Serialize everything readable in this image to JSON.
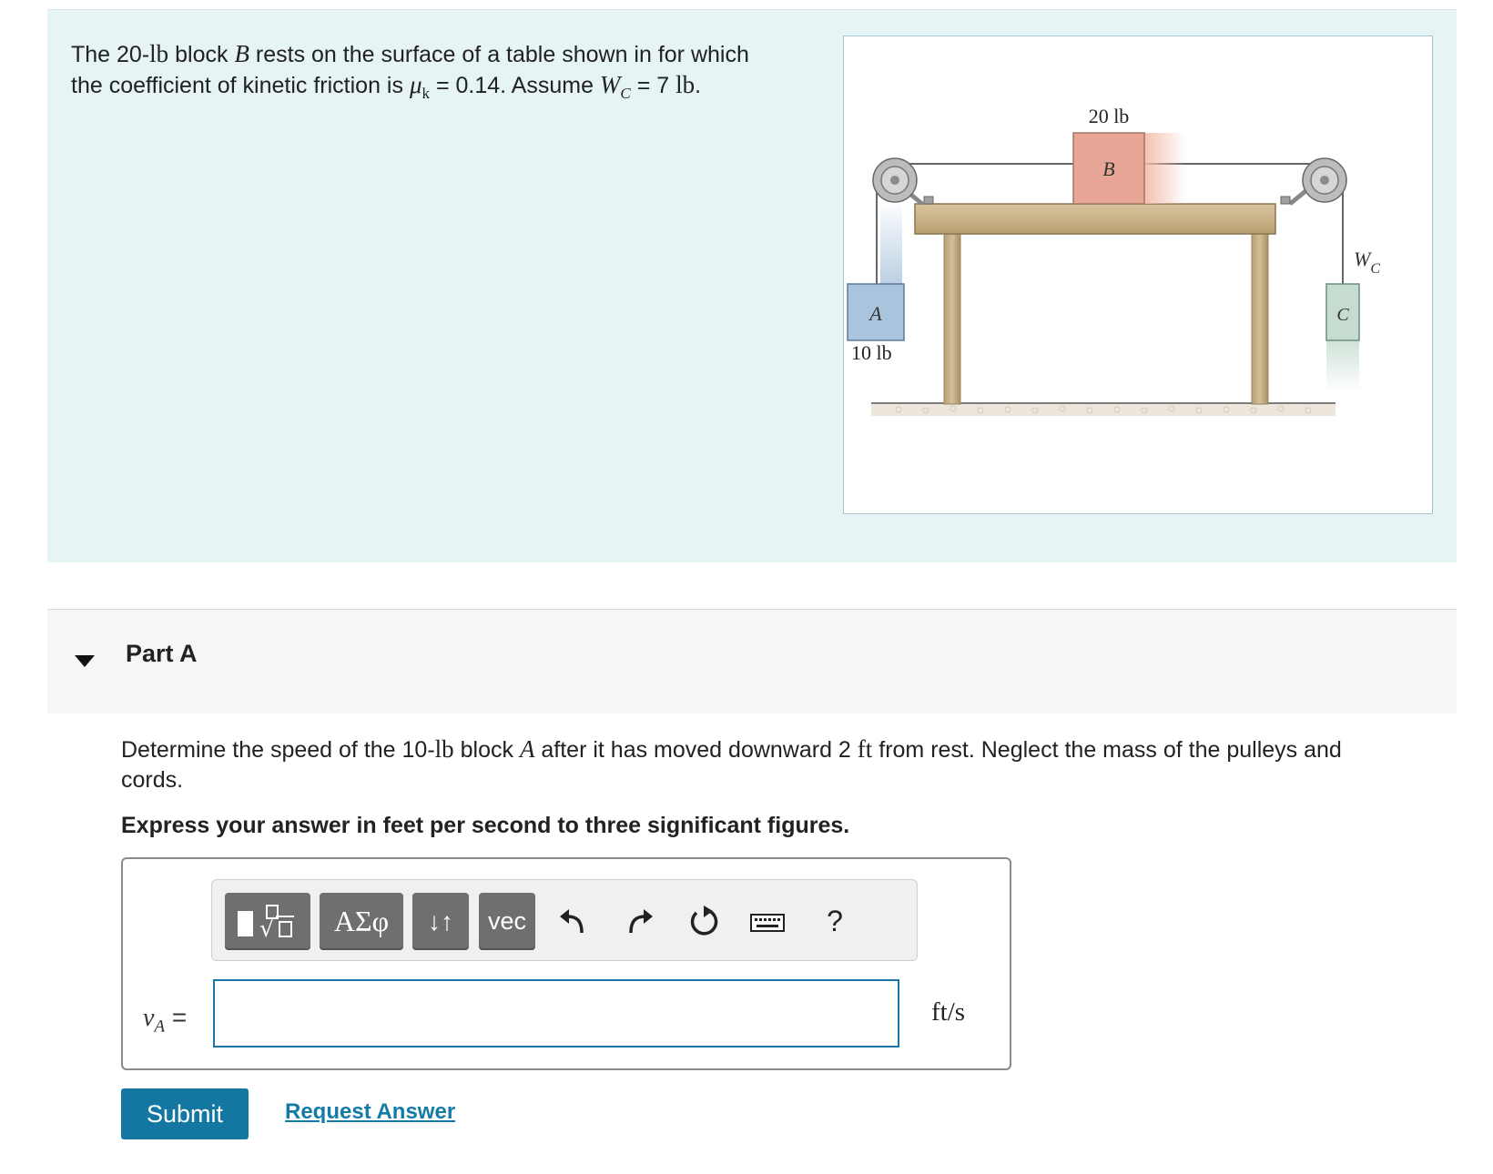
{
  "intro": {
    "line1_pre": "The 20-",
    "line1_unit": "lb",
    "line1_mid": " block ",
    "line1_var": "B",
    "line1_post": " rests on the surface of a table shown in for which",
    "line2_pre": "the coefficient of kinetic friction is ",
    "mu_symbol": "μ",
    "mu_sub": "k",
    "mu_value": " = 0.14. Assume ",
    "wc_symbol": "W",
    "wc_sub": "C",
    "wc_value": " = 7 ",
    "wc_unit": "lb",
    "end": "."
  },
  "figure": {
    "label_b_weight": "20 lb",
    "label_b": "B",
    "label_a": "A",
    "label_a_weight": "10 lb",
    "label_c": "C",
    "label_wc": "W",
    "label_wc_sub": "C",
    "colors": {
      "block_b": "#e8a796",
      "block_a": "#a9c4dd",
      "block_c": "#c6dcd0",
      "table": "#c9b48c",
      "pulley": "#b8b8b8"
    }
  },
  "part": {
    "title": "Part A"
  },
  "question": {
    "pre": "Determine the speed of the 10-",
    "unit1": "lb",
    "mid1": " block ",
    "var": "A",
    "mid2": " after it has moved downward 2 ",
    "unit2": "ft",
    "post": " from rest. Neglect the mass of the pulleys and",
    "line2": "cords.",
    "instruction": "Express your answer in feet per second to three significant figures."
  },
  "toolbar": {
    "greek_label": "ΑΣφ",
    "arrows_label": "↓↑",
    "vec_label": "vec",
    "help_label": "?",
    "icons": [
      "templates-icon",
      "undo-icon",
      "redo-icon",
      "reset-icon",
      "keyboard-icon"
    ]
  },
  "answer": {
    "var_symbol": "v",
    "var_sub": "A",
    "equals": " =",
    "value": "",
    "units": "ft/s"
  },
  "actions": {
    "submit_label": "Submit",
    "request_label": "Request Answer"
  }
}
